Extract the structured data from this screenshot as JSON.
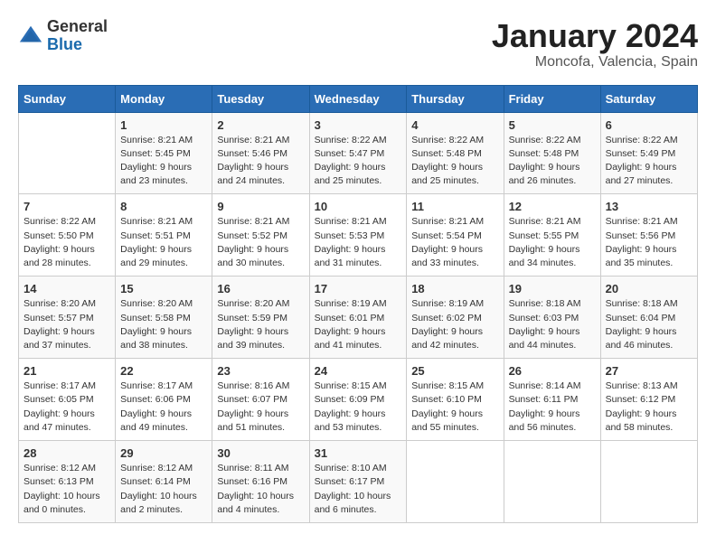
{
  "header": {
    "logo_general": "General",
    "logo_blue": "Blue",
    "month_title": "January 2024",
    "location": "Moncofa, Valencia, Spain"
  },
  "days_of_week": [
    "Sunday",
    "Monday",
    "Tuesday",
    "Wednesday",
    "Thursday",
    "Friday",
    "Saturday"
  ],
  "weeks": [
    [
      {
        "day": "",
        "sunrise": "",
        "sunset": "",
        "daylight": ""
      },
      {
        "day": "1",
        "sunrise": "Sunrise: 8:21 AM",
        "sunset": "Sunset: 5:45 PM",
        "daylight": "Daylight: 9 hours and 23 minutes."
      },
      {
        "day": "2",
        "sunrise": "Sunrise: 8:21 AM",
        "sunset": "Sunset: 5:46 PM",
        "daylight": "Daylight: 9 hours and 24 minutes."
      },
      {
        "day": "3",
        "sunrise": "Sunrise: 8:22 AM",
        "sunset": "Sunset: 5:47 PM",
        "daylight": "Daylight: 9 hours and 25 minutes."
      },
      {
        "day": "4",
        "sunrise": "Sunrise: 8:22 AM",
        "sunset": "Sunset: 5:48 PM",
        "daylight": "Daylight: 9 hours and 25 minutes."
      },
      {
        "day": "5",
        "sunrise": "Sunrise: 8:22 AM",
        "sunset": "Sunset: 5:48 PM",
        "daylight": "Daylight: 9 hours and 26 minutes."
      },
      {
        "day": "6",
        "sunrise": "Sunrise: 8:22 AM",
        "sunset": "Sunset: 5:49 PM",
        "daylight": "Daylight: 9 hours and 27 minutes."
      }
    ],
    [
      {
        "day": "7",
        "sunrise": "Sunrise: 8:22 AM",
        "sunset": "Sunset: 5:50 PM",
        "daylight": "Daylight: 9 hours and 28 minutes."
      },
      {
        "day": "8",
        "sunrise": "Sunrise: 8:21 AM",
        "sunset": "Sunset: 5:51 PM",
        "daylight": "Daylight: 9 hours and 29 minutes."
      },
      {
        "day": "9",
        "sunrise": "Sunrise: 8:21 AM",
        "sunset": "Sunset: 5:52 PM",
        "daylight": "Daylight: 9 hours and 30 minutes."
      },
      {
        "day": "10",
        "sunrise": "Sunrise: 8:21 AM",
        "sunset": "Sunset: 5:53 PM",
        "daylight": "Daylight: 9 hours and 31 minutes."
      },
      {
        "day": "11",
        "sunrise": "Sunrise: 8:21 AM",
        "sunset": "Sunset: 5:54 PM",
        "daylight": "Daylight: 9 hours and 33 minutes."
      },
      {
        "day": "12",
        "sunrise": "Sunrise: 8:21 AM",
        "sunset": "Sunset: 5:55 PM",
        "daylight": "Daylight: 9 hours and 34 minutes."
      },
      {
        "day": "13",
        "sunrise": "Sunrise: 8:21 AM",
        "sunset": "Sunset: 5:56 PM",
        "daylight": "Daylight: 9 hours and 35 minutes."
      }
    ],
    [
      {
        "day": "14",
        "sunrise": "Sunrise: 8:20 AM",
        "sunset": "Sunset: 5:57 PM",
        "daylight": "Daylight: 9 hours and 37 minutes."
      },
      {
        "day": "15",
        "sunrise": "Sunrise: 8:20 AM",
        "sunset": "Sunset: 5:58 PM",
        "daylight": "Daylight: 9 hours and 38 minutes."
      },
      {
        "day": "16",
        "sunrise": "Sunrise: 8:20 AM",
        "sunset": "Sunset: 5:59 PM",
        "daylight": "Daylight: 9 hours and 39 minutes."
      },
      {
        "day": "17",
        "sunrise": "Sunrise: 8:19 AM",
        "sunset": "Sunset: 6:01 PM",
        "daylight": "Daylight: 9 hours and 41 minutes."
      },
      {
        "day": "18",
        "sunrise": "Sunrise: 8:19 AM",
        "sunset": "Sunset: 6:02 PM",
        "daylight": "Daylight: 9 hours and 42 minutes."
      },
      {
        "day": "19",
        "sunrise": "Sunrise: 8:18 AM",
        "sunset": "Sunset: 6:03 PM",
        "daylight": "Daylight: 9 hours and 44 minutes."
      },
      {
        "day": "20",
        "sunrise": "Sunrise: 8:18 AM",
        "sunset": "Sunset: 6:04 PM",
        "daylight": "Daylight: 9 hours and 46 minutes."
      }
    ],
    [
      {
        "day": "21",
        "sunrise": "Sunrise: 8:17 AM",
        "sunset": "Sunset: 6:05 PM",
        "daylight": "Daylight: 9 hours and 47 minutes."
      },
      {
        "day": "22",
        "sunrise": "Sunrise: 8:17 AM",
        "sunset": "Sunset: 6:06 PM",
        "daylight": "Daylight: 9 hours and 49 minutes."
      },
      {
        "day": "23",
        "sunrise": "Sunrise: 8:16 AM",
        "sunset": "Sunset: 6:07 PM",
        "daylight": "Daylight: 9 hours and 51 minutes."
      },
      {
        "day": "24",
        "sunrise": "Sunrise: 8:15 AM",
        "sunset": "Sunset: 6:09 PM",
        "daylight": "Daylight: 9 hours and 53 minutes."
      },
      {
        "day": "25",
        "sunrise": "Sunrise: 8:15 AM",
        "sunset": "Sunset: 6:10 PM",
        "daylight": "Daylight: 9 hours and 55 minutes."
      },
      {
        "day": "26",
        "sunrise": "Sunrise: 8:14 AM",
        "sunset": "Sunset: 6:11 PM",
        "daylight": "Daylight: 9 hours and 56 minutes."
      },
      {
        "day": "27",
        "sunrise": "Sunrise: 8:13 AM",
        "sunset": "Sunset: 6:12 PM",
        "daylight": "Daylight: 9 hours and 58 minutes."
      }
    ],
    [
      {
        "day": "28",
        "sunrise": "Sunrise: 8:12 AM",
        "sunset": "Sunset: 6:13 PM",
        "daylight": "Daylight: 10 hours and 0 minutes."
      },
      {
        "day": "29",
        "sunrise": "Sunrise: 8:12 AM",
        "sunset": "Sunset: 6:14 PM",
        "daylight": "Daylight: 10 hours and 2 minutes."
      },
      {
        "day": "30",
        "sunrise": "Sunrise: 8:11 AM",
        "sunset": "Sunset: 6:16 PM",
        "daylight": "Daylight: 10 hours and 4 minutes."
      },
      {
        "day": "31",
        "sunrise": "Sunrise: 8:10 AM",
        "sunset": "Sunset: 6:17 PM",
        "daylight": "Daylight: 10 hours and 6 minutes."
      },
      {
        "day": "",
        "sunrise": "",
        "sunset": "",
        "daylight": ""
      },
      {
        "day": "",
        "sunrise": "",
        "sunset": "",
        "daylight": ""
      },
      {
        "day": "",
        "sunrise": "",
        "sunset": "",
        "daylight": ""
      }
    ]
  ]
}
